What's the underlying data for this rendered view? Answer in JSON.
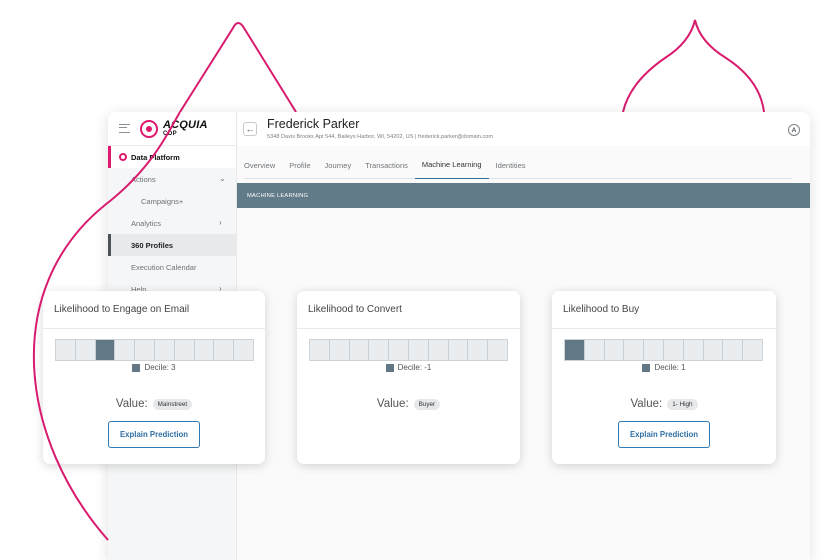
{
  "sidebar": {
    "logo": {
      "name": "ACQUIA",
      "sub": "CDP"
    },
    "section": "Data Platform",
    "items": [
      {
        "label": "Actions",
        "chevron": "down"
      },
      {
        "label": "Campaigns+"
      },
      {
        "label": "Analytics",
        "chevron": "right"
      },
      {
        "label": "360 Profiles",
        "active": true
      },
      {
        "label": "Execution Calendar"
      },
      {
        "label": "Help",
        "chevron": "right"
      }
    ]
  },
  "header": {
    "name": "Frederick Parker",
    "address": "5348 Davis Brooks Apt 544, Baileys Harbor, WI, 54202, US | frederick.parker@domain.com",
    "avatar": "A"
  },
  "tabs": [
    {
      "label": "Overview"
    },
    {
      "label": "Profile"
    },
    {
      "label": "Journey"
    },
    {
      "label": "Transactions"
    },
    {
      "label": "Machine Learning",
      "active": true
    },
    {
      "label": "Identities"
    }
  ],
  "section_title": "MACHINE LEARNING",
  "cards": [
    {
      "title": "Likelihood to Engage on Email",
      "decile_label": "Decile: 3",
      "active_decile": 3,
      "value_label": "Value:",
      "value": "Mainstreet",
      "button": "Explain Prediction"
    },
    {
      "title": "Likelihood to Convert",
      "decile_label": "Decile: -1",
      "active_decile": -1,
      "value_label": "Value:",
      "value": "Buyer"
    },
    {
      "title": "Likelihood to Buy",
      "decile_label": "Decile: 1",
      "active_decile": 1,
      "value_label": "Value:",
      "value": "1- High",
      "button": "Explain Prediction"
    }
  ],
  "colors": {
    "accent": "#e0196f",
    "section_bar": "#627b89",
    "decile_on": "#637886",
    "link": "#2f6ea3"
  }
}
